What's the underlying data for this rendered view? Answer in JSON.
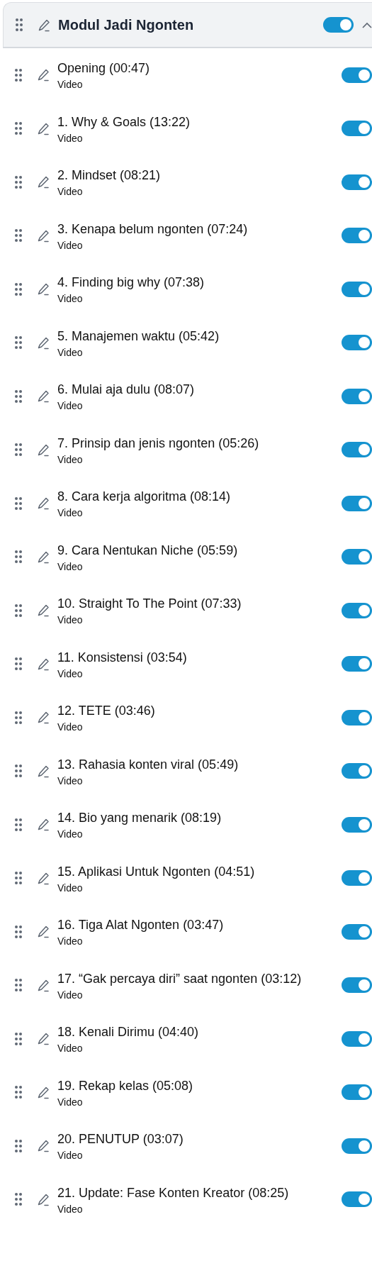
{
  "module": {
    "title": "Modul Jadi Ngonten",
    "enabled": true,
    "expanded": true
  },
  "lessons": [
    {
      "title": "Opening (00:47)",
      "type": "Video",
      "enabled": true
    },
    {
      "title": "1. Why & Goals (13:22)",
      "type": "Video",
      "enabled": true
    },
    {
      "title": "2. Mindset (08:21)",
      "type": "Video",
      "enabled": true
    },
    {
      "title": "3. Kenapa belum ngonten (07:24)",
      "type": "Video",
      "enabled": true
    },
    {
      "title": "4. Finding big why (07:38)",
      "type": "Video",
      "enabled": true
    },
    {
      "title": "5. Manajemen waktu (05:42)",
      "type": "Video",
      "enabled": true
    },
    {
      "title": "6. Mulai aja dulu (08:07)",
      "type": "Video",
      "enabled": true
    },
    {
      "title": "7. Prinsip dan jenis ngonten (05:26)",
      "type": "Video",
      "enabled": true
    },
    {
      "title": "8. Cara kerja algoritma (08:14)",
      "type": "Video",
      "enabled": true
    },
    {
      "title": "9. Cara Nentukan Niche (05:59)",
      "type": "Video",
      "enabled": true
    },
    {
      "title": "10. Straight To The Point (07:33)",
      "type": "Video",
      "enabled": true
    },
    {
      "title": "11. Konsistensi (03:54)",
      "type": "Video",
      "enabled": true
    },
    {
      "title": "12. TETE (03:46)",
      "type": "Video",
      "enabled": true
    },
    {
      "title": "13. Rahasia konten viral (05:49)",
      "type": "Video",
      "enabled": true
    },
    {
      "title": "14. Bio yang menarik (08:19)",
      "type": "Video",
      "enabled": true
    },
    {
      "title": "15. Aplikasi Untuk Ngonten (04:51)",
      "type": "Video",
      "enabled": true
    },
    {
      "title": "16. Tiga Alat Ngonten (03:47)",
      "type": "Video",
      "enabled": true
    },
    {
      "title": "17. “Gak percaya diri” saat ngonten (03:12)",
      "type": "Video",
      "enabled": true
    },
    {
      "title": "18. Kenali Dirimu (04:40)",
      "type": "Video",
      "enabled": true
    },
    {
      "title": "19. Rekap kelas (05:08)",
      "type": "Video",
      "enabled": true
    },
    {
      "title": "20. PENUTUP (03:07)",
      "type": "Video",
      "enabled": true
    },
    {
      "title": "21. Update: Fase Konten Kreator (08:25)",
      "type": "Video",
      "enabled": true
    }
  ]
}
